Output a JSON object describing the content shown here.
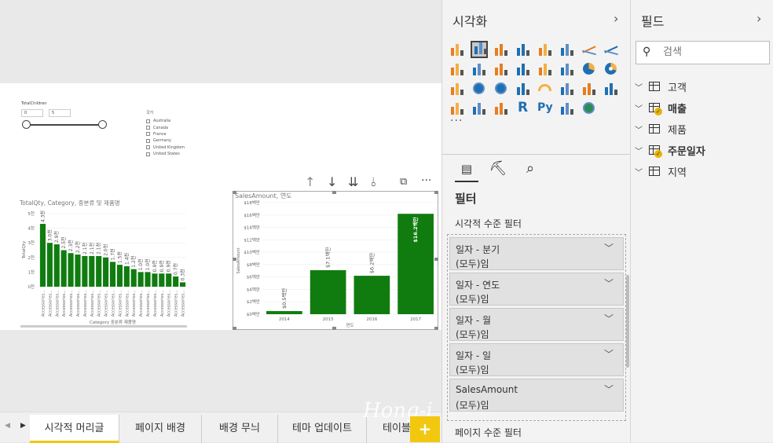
{
  "slicer_qty": {
    "title": "TotalChildren",
    "min": "0",
    "max": "5"
  },
  "slicer_country": {
    "header": "국가",
    "items": [
      "Australia",
      "Canada",
      "France",
      "Germany",
      "United Kingdom",
      "United States"
    ]
  },
  "chart_data": [
    {
      "type": "bar",
      "title": "TotalQty, Category, 중분류 및 제품명",
      "ylabel": "TotalQty",
      "xlabel": "Category 중분류 제품명",
      "ytick_labels": [
        "5천",
        "4천",
        "3천",
        "2천",
        "1천",
        "0천"
      ],
      "ylim": [
        0,
        5000
      ],
      "categories": [
        "Accessories...",
        "Accessories...",
        "Accessories...",
        "Accessories...",
        "Accessories...",
        "Accessories...",
        "Accessories...",
        "Accessories...",
        "Accessories...",
        "Accessories...",
        "Accessories...",
        "Accessories...",
        "Accessories...",
        "Accessories...",
        "Accessories...",
        "Accessories...",
        "Accessories...",
        "Accessories...",
        "Accessories...",
        "Accessories...",
        "Accessories..."
      ],
      "values": [
        4300,
        3000,
        2900,
        2500,
        2300,
        2200,
        2100,
        2100,
        2100,
        2000,
        1700,
        1500,
        1400,
        1200,
        1000,
        1000,
        900,
        900,
        900,
        700,
        300
      ],
      "data_labels": [
        "4.3천",
        "3.0천",
        "2.9천",
        "2.5천",
        "2.3천",
        "2.2천",
        "2.1천",
        "2.1천",
        "2.1천",
        "2.0천",
        "1.7천",
        "1.5천",
        "1.4천",
        "1.2천",
        "1.0천",
        "1.0천",
        "0.9천",
        "0.9천",
        "0.9천",
        "0.7천",
        "0.3천"
      ],
      "color": "#107c10"
    },
    {
      "type": "bar",
      "title": "SalesAmount, 연도",
      "ylabel": "SalesAmount",
      "xlabel": "연도",
      "ytick_labels": [
        "$18백만",
        "$16백만",
        "$14백만",
        "$12백만",
        "$10백만",
        "$8백만",
        "$6백만",
        "$4백만",
        "$2백만",
        "$0백만"
      ],
      "ylim": [
        0,
        18
      ],
      "categories": [
        "2014",
        "2015",
        "2016",
        "2017"
      ],
      "values": [
        0.5,
        7.1,
        6.2,
        16.2
      ],
      "data_labels": [
        "$0.5백만",
        "$7.1백만",
        "$6.2백만",
        "$16.2백만"
      ],
      "color": "#107c10"
    }
  ],
  "tabs": {
    "items": [
      "시각적 머리글",
      "페이지 배경",
      "배경 무늬",
      "테마 업데이트",
      "테이블"
    ],
    "active": 0,
    "add": "+"
  },
  "viz_pane": {
    "title": "시각화",
    "more": "···",
    "filters_title": "필터",
    "visual_level": "시각적 수준 필터",
    "page_level": "페이지 수준 필터",
    "filters": [
      {
        "name": "일자 - 분기",
        "value": "(모두)임"
      },
      {
        "name": "일자 - 연도",
        "value": "(모두)임"
      },
      {
        "name": "일자 - 월",
        "value": "(모두)임"
      },
      {
        "name": "일자 - 일",
        "value": "(모두)임"
      },
      {
        "name": "SalesAmount",
        "value": "(모두)임"
      }
    ]
  },
  "fields_pane": {
    "title": "필드",
    "search_placeholder": "검색",
    "tables": [
      {
        "name": "고객",
        "checked": false
      },
      {
        "name": "매출",
        "checked": true
      },
      {
        "name": "제품",
        "checked": false
      },
      {
        "name": "주문일자",
        "checked": true
      },
      {
        "name": "지역",
        "checked": false
      }
    ]
  },
  "watermark": "Hong-i",
  "colors": {
    "bar": "#107c10",
    "accent": "#f2c80f",
    "badge": "#e8b400"
  }
}
